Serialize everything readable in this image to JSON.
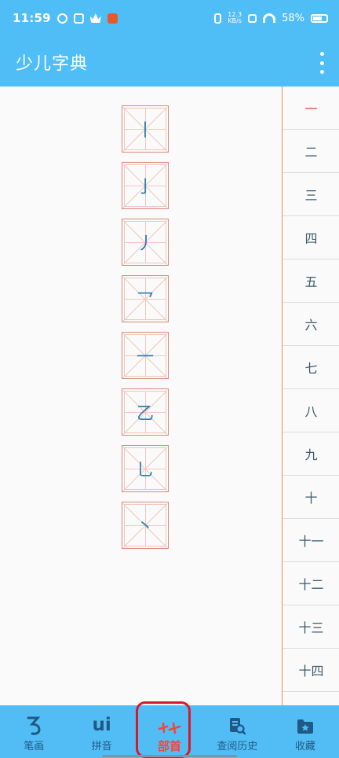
{
  "status_bar": {
    "time": "11:59",
    "net_speed_value": "12.3",
    "net_speed_unit": "KB/s",
    "battery": "58%"
  },
  "app_bar": {
    "title": "少儿字典"
  },
  "radicals": [
    "丨",
    "亅",
    "丿",
    "乛",
    "一",
    "乙",
    "乚",
    "丶"
  ],
  "stroke_index": [
    "一",
    "二",
    "三",
    "四",
    "五",
    "六",
    "七",
    "八",
    "九",
    "十",
    "十一",
    "十二",
    "十三",
    "十四"
  ],
  "stroke_index_active": 0,
  "bottom_nav": {
    "items": [
      {
        "label": "笔画"
      },
      {
        "label": "拼音"
      },
      {
        "label": "部首"
      },
      {
        "label": "查阅历史"
      },
      {
        "label": "收藏"
      }
    ],
    "selected": 2
  },
  "colors": {
    "primary": "#4fbdf6",
    "accent_red": "#ec4a3c",
    "glyph_blue": "#2b7fb2"
  }
}
